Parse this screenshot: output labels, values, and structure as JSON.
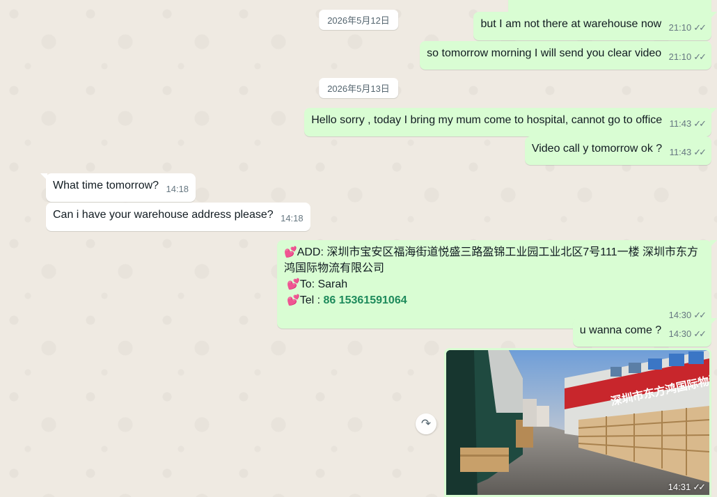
{
  "dates": {
    "may12": "2026年5月12日",
    "may13": "2026年5月13日"
  },
  "messages": [
    {
      "text": "but I am not there at warehouse now",
      "time": "21:10"
    },
    {
      "text": "so tomorrow morning I will send you clear video",
      "time": "21:10"
    },
    {
      "text": "Hello sorry , today I bring my mum come to hospital, cannot go to office",
      "time": "11:43"
    },
    {
      "text": "Video call y tomorrow ok ?",
      "time": "11:43"
    },
    {
      "text": "What time tomorrow?",
      "time": "14:18"
    },
    {
      "text": "Can i have your warehouse address please?",
      "time": "14:18"
    },
    {
      "add": "ADD: 深圳市宝安区福海街道悦盛三路盈锦工业园工业北区7号111一楼 深圳市东方鸿国际物流有限公司",
      "to": "To: Sarah",
      "tel_label": "Tel : ",
      "tel": "86 15361591064",
      "time": "14:30"
    },
    {
      "text": "u wanna come ?",
      "time": "14:30"
    },
    {
      "time": "14:31",
      "sign_text": "深圳市东方鸿国际物流"
    }
  ],
  "icons": {
    "read": "double-check-icon",
    "forward": "forward-icon",
    "heart": "heart-icon"
  },
  "colors": {
    "outgoing": "#d9fdd3",
    "incoming": "#ffffff",
    "background": "#efeae2",
    "phone": "#1d8a5b"
  }
}
